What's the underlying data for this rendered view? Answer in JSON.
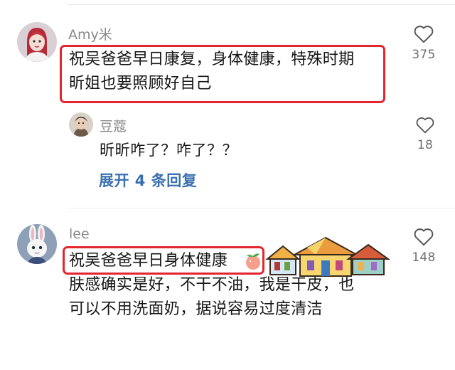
{
  "comments": [
    {
      "username": "Amy米",
      "lines": [
        "祝吴爸爸早日康复，身体健康，特殊时期",
        "昕姐也要照顾好自己"
      ],
      "likes": "375",
      "replies": [
        {
          "username": "豆蔻",
          "text": "昕昕咋了？咋了？？",
          "likes": "18"
        }
      ],
      "expand_label": "展开 4 条回复"
    },
    {
      "username": "lee",
      "lines": [
        "祝吴爸爸早日身体健康",
        "肤感确实是好，不干不油，我是干皮，也",
        "可以不用洗面奶，据说容易过度清洁"
      ],
      "likes": "148"
    }
  ],
  "colors": {
    "highlight_box": "#e3262e",
    "link_blue": "#3b6fb0",
    "username_gray": "#8a8a8a"
  }
}
